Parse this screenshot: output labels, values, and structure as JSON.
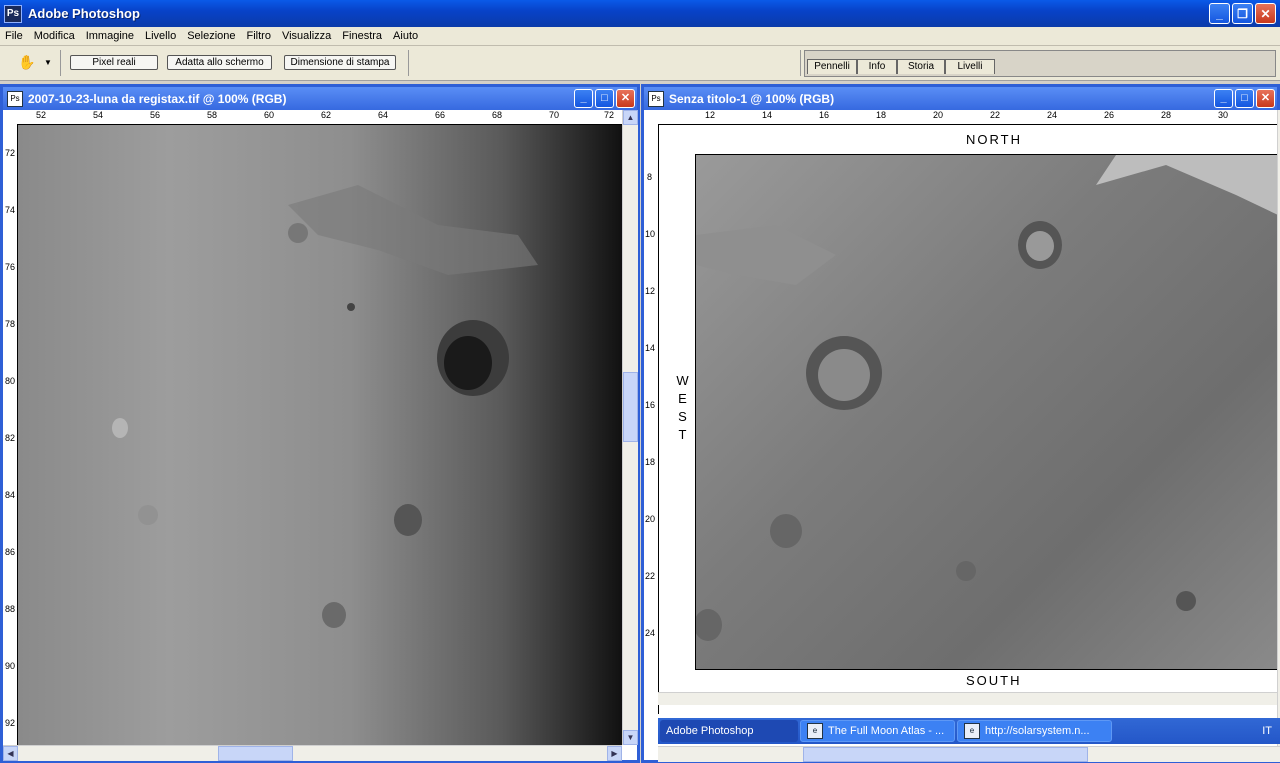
{
  "app": {
    "title": "Adobe Photoshop",
    "icon": "photoshop-icon"
  },
  "menu": [
    "File",
    "Modifica",
    "Immagine",
    "Livello",
    "Selezione",
    "Filtro",
    "Visualizza",
    "Finestra",
    "Aiuto"
  ],
  "options": {
    "pixel_reali": "Pixel reali",
    "adatta": "Adatta allo schermo",
    "dimensione": "Dimensione di stampa"
  },
  "palette_tabs": [
    "Pennelli",
    "Info",
    "Storia",
    "Livelli"
  ],
  "doc1": {
    "title": "2007-10-23-luna da registax.tif @ 100% (RGB)",
    "hruler": [
      "52",
      "54",
      "56",
      "58",
      "60",
      "62",
      "64",
      "66",
      "68",
      "70",
      "72"
    ],
    "vruler": [
      "72",
      "74",
      "76",
      "78",
      "80",
      "82",
      "84",
      "86",
      "88",
      "90",
      "92"
    ]
  },
  "doc2": {
    "title": "Senza titolo-1 @ 100% (RGB)",
    "hruler": [
      "12",
      "14",
      "16",
      "18",
      "20",
      "22",
      "24",
      "26",
      "28",
      "30"
    ],
    "vruler": [
      "8",
      "10",
      "12",
      "14",
      "16",
      "18",
      "20",
      "22",
      "24"
    ],
    "north": "NORTH",
    "south": "SOUTH",
    "west": "WEST"
  },
  "taskbar": {
    "items": [
      "Adobe Photoshop",
      "The Full Moon Atlas - ...",
      "http://solarsystem.n..."
    ],
    "lang": "IT"
  },
  "colors": {
    "titlebar": "#0842c8",
    "doc_border": "#2e5fd6",
    "menu_bg": "#ece9d8"
  }
}
